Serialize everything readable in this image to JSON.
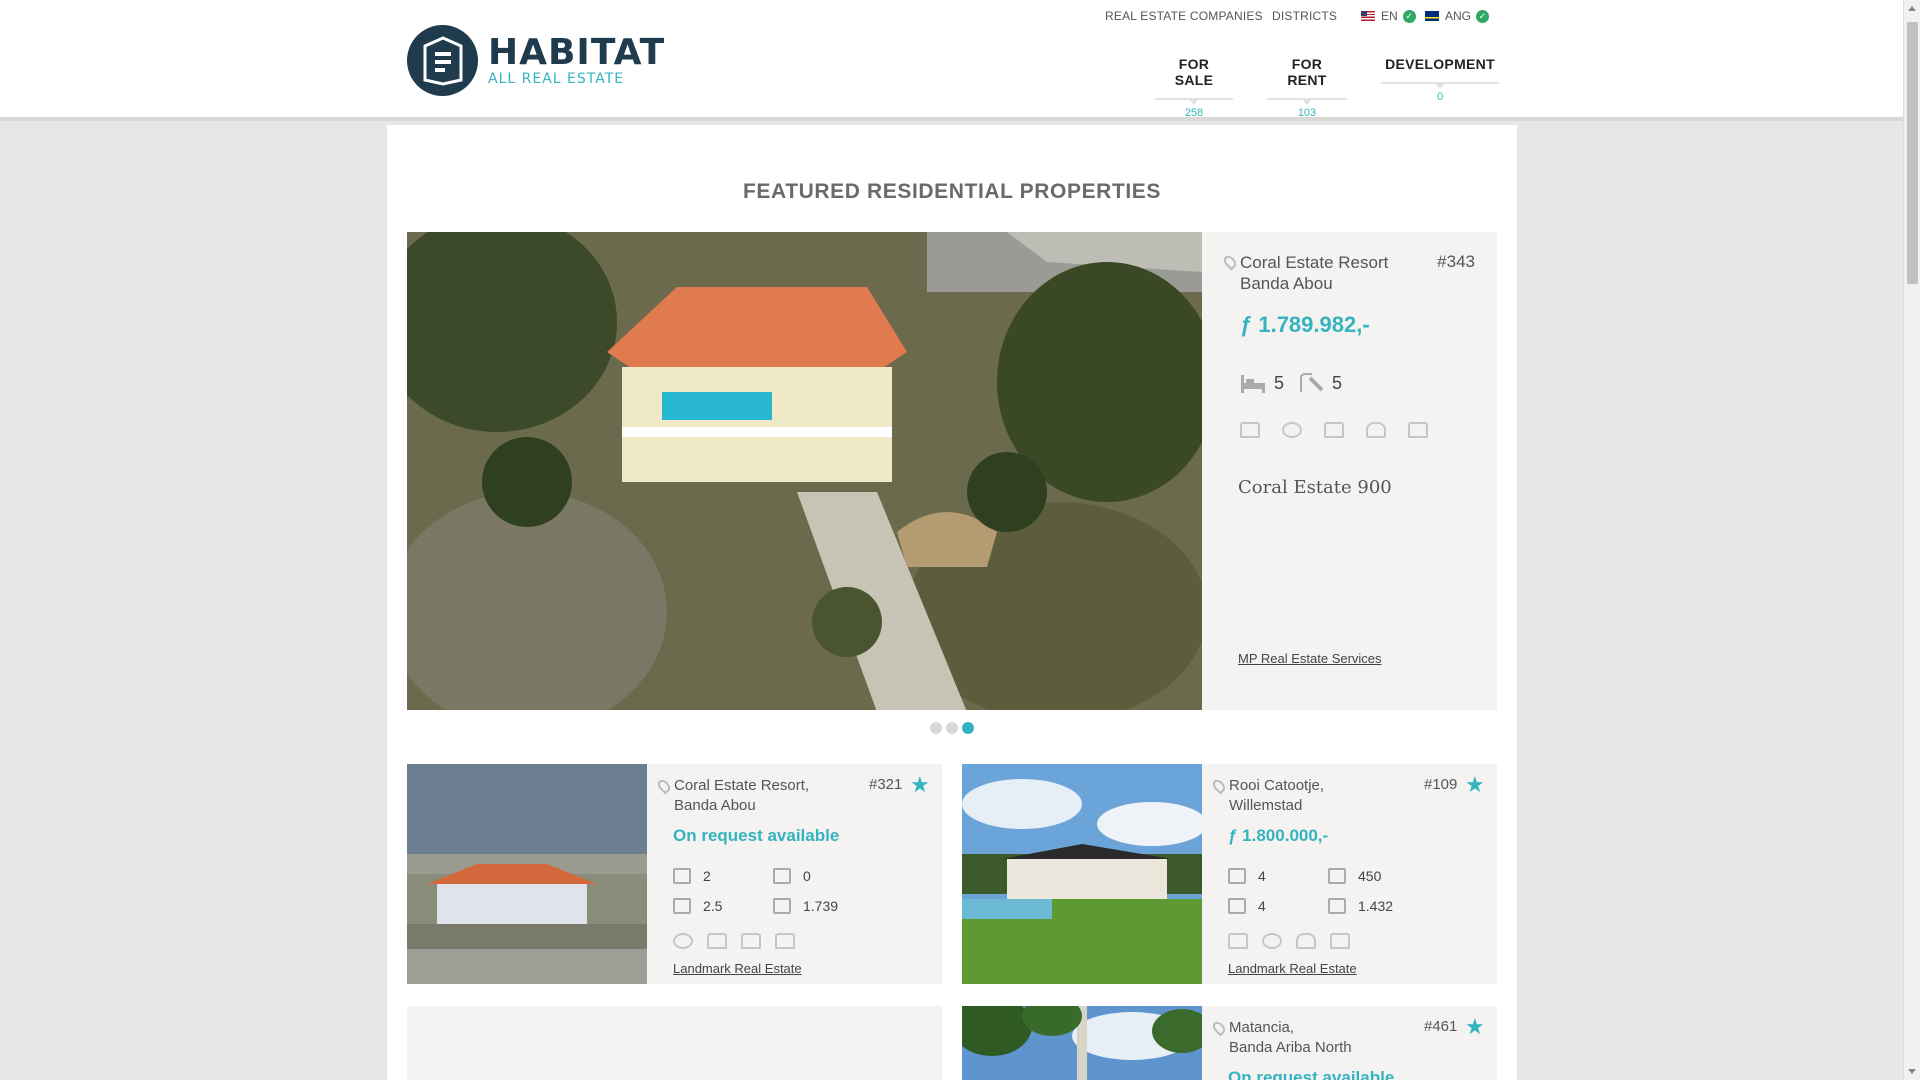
{
  "brand": {
    "name": "HABITAT",
    "tagline": "ALL REAL ESTATE"
  },
  "util_nav": [
    {
      "label": "REAL ESTATE COMPANIES"
    },
    {
      "label": "DISTRICTS"
    }
  ],
  "languages": [
    {
      "code": "EN",
      "selected": true
    },
    {
      "code": "ANG",
      "selected": true
    }
  ],
  "main_nav": [
    {
      "label": "FOR SALE",
      "count": "258"
    },
    {
      "label": "FOR RENT",
      "count": "103"
    },
    {
      "label": "DEVELOPMENT",
      "count": "0"
    }
  ],
  "section_title": "FEATURED RESIDENTIAL PROPERTIES",
  "featured": {
    "location_line1": "Coral Estate Resort",
    "location_line2": "Banda Abou",
    "id": "#343",
    "price": "ƒ 1.789.982,-",
    "beds": "5",
    "baths": "5",
    "amenity_icons": [
      "house-icon",
      "pool-icon",
      "fence-icon",
      "car-icon",
      "garage-icon"
    ],
    "name": "Coral Estate 900",
    "agency": "MP Real Estate Services"
  },
  "slider": {
    "total": 3,
    "active_index": 2
  },
  "listings": [
    {
      "location_line1": "Coral Estate Resort,",
      "location_line2": "Banda Abou",
      "id": "#321",
      "price": "On request available",
      "beds": "2",
      "land": "0",
      "baths": "2.5",
      "area": "1.739",
      "amenity_icons": [
        "pool-icon",
        "fence-icon",
        "garage-icon",
        "carport-icon"
      ],
      "agency": "Landmark Real Estate"
    },
    {
      "location_line1": "Rooi Catootje,",
      "location_line2": "Willemstad",
      "id": "#109",
      "price": "ƒ 1.800.000,-",
      "beds": "4",
      "land": "450",
      "baths": "4",
      "area": "1.432",
      "amenity_icons": [
        "house-icon",
        "pool-icon",
        "car-icon",
        "garage-icon"
      ],
      "agency": "Landmark Real Estate"
    },
    {
      "location_line1": "Matancia,",
      "location_line2": "Banda Ariba North",
      "id": "#461",
      "price": "On request available"
    }
  ]
}
